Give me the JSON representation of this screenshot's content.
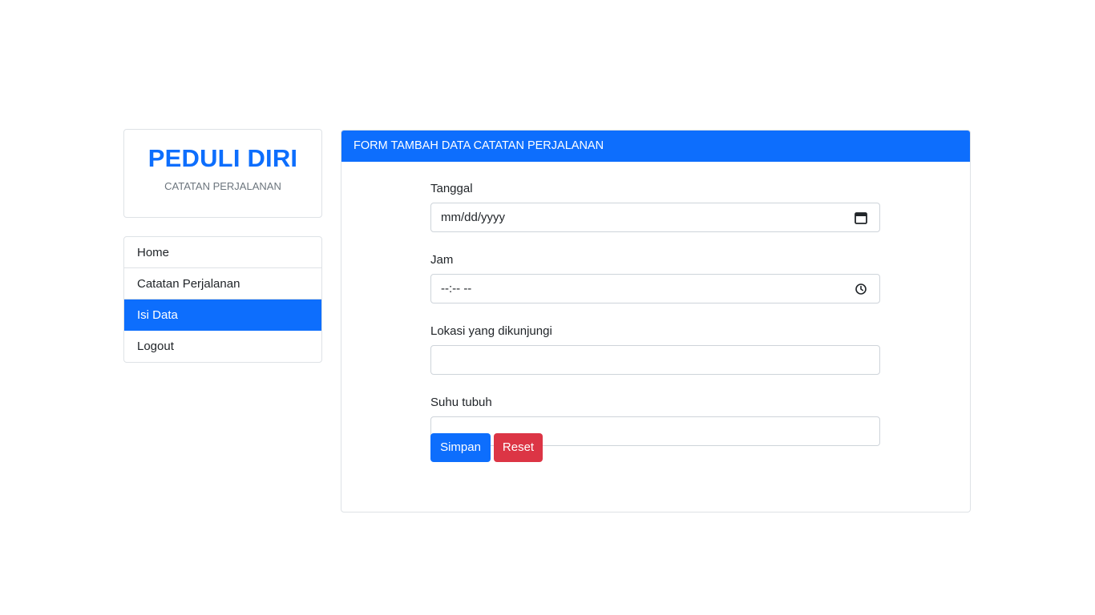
{
  "brand": {
    "title": "PEDULI DIRI",
    "subtitle": "CATATAN PERJALANAN"
  },
  "nav": {
    "items": [
      {
        "label": "Home",
        "active": false
      },
      {
        "label": "Catatan Perjalanan",
        "active": false
      },
      {
        "label": "Isi Data",
        "active": true
      },
      {
        "label": "Logout",
        "active": false
      }
    ]
  },
  "form": {
    "header": "FORM TAMBAH DATA CATATAN PERJALANAN",
    "fields": {
      "tanggal": {
        "label": "Tanggal",
        "value": "mm/dd/yyyy",
        "icon": "calendar-icon"
      },
      "jam": {
        "label": "Jam",
        "value": "--:-- --",
        "icon": "clock-icon"
      },
      "lokasi": {
        "label": "Lokasi yang dikunjungi",
        "value": ""
      },
      "suhu": {
        "label": "Suhu tubuh",
        "value": ""
      }
    },
    "buttons": {
      "save": "Simpan",
      "reset": "Reset"
    }
  },
  "colors": {
    "primary": "#0d6efd",
    "danger": "#dc3545",
    "border": "#dee2e6",
    "muted": "#6c757d"
  }
}
